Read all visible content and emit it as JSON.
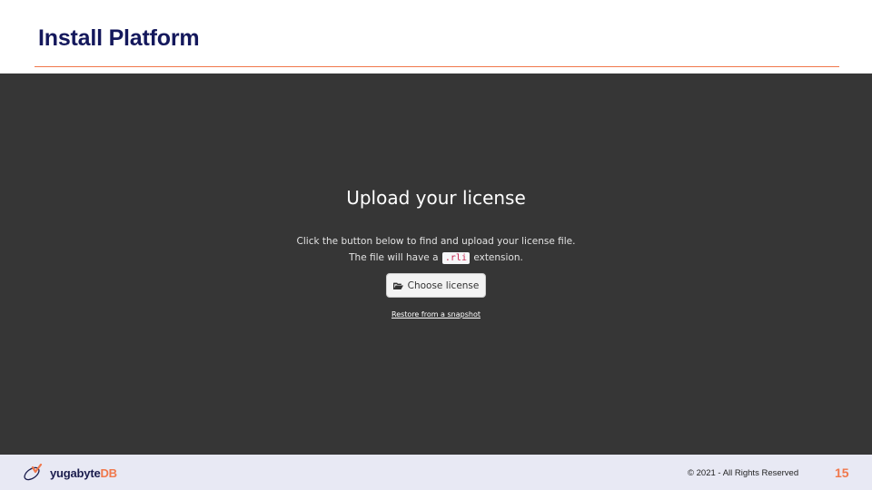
{
  "slide": {
    "title": "Install Platform",
    "copyright": "© 2021 - All Rights Reserved",
    "page_number": "15"
  },
  "logo": {
    "text_main": "yugabyte",
    "text_accent": "DB"
  },
  "upload": {
    "heading": "Upload your license",
    "line1": "Click the button below to find and upload your license file.",
    "line2_prefix": "The file will have a",
    "extension": ".rli",
    "line2_suffix": "extension.",
    "choose_label": "Choose license",
    "restore_label": "Restore from a snapshot"
  },
  "icons": {
    "folder": "folder-open-icon",
    "logo": "yugabyte-logo-icon"
  },
  "colors": {
    "title": "#14185c",
    "accent": "#f0784c",
    "panel_bg": "#363636",
    "footer_bg": "#e8e9f4"
  }
}
